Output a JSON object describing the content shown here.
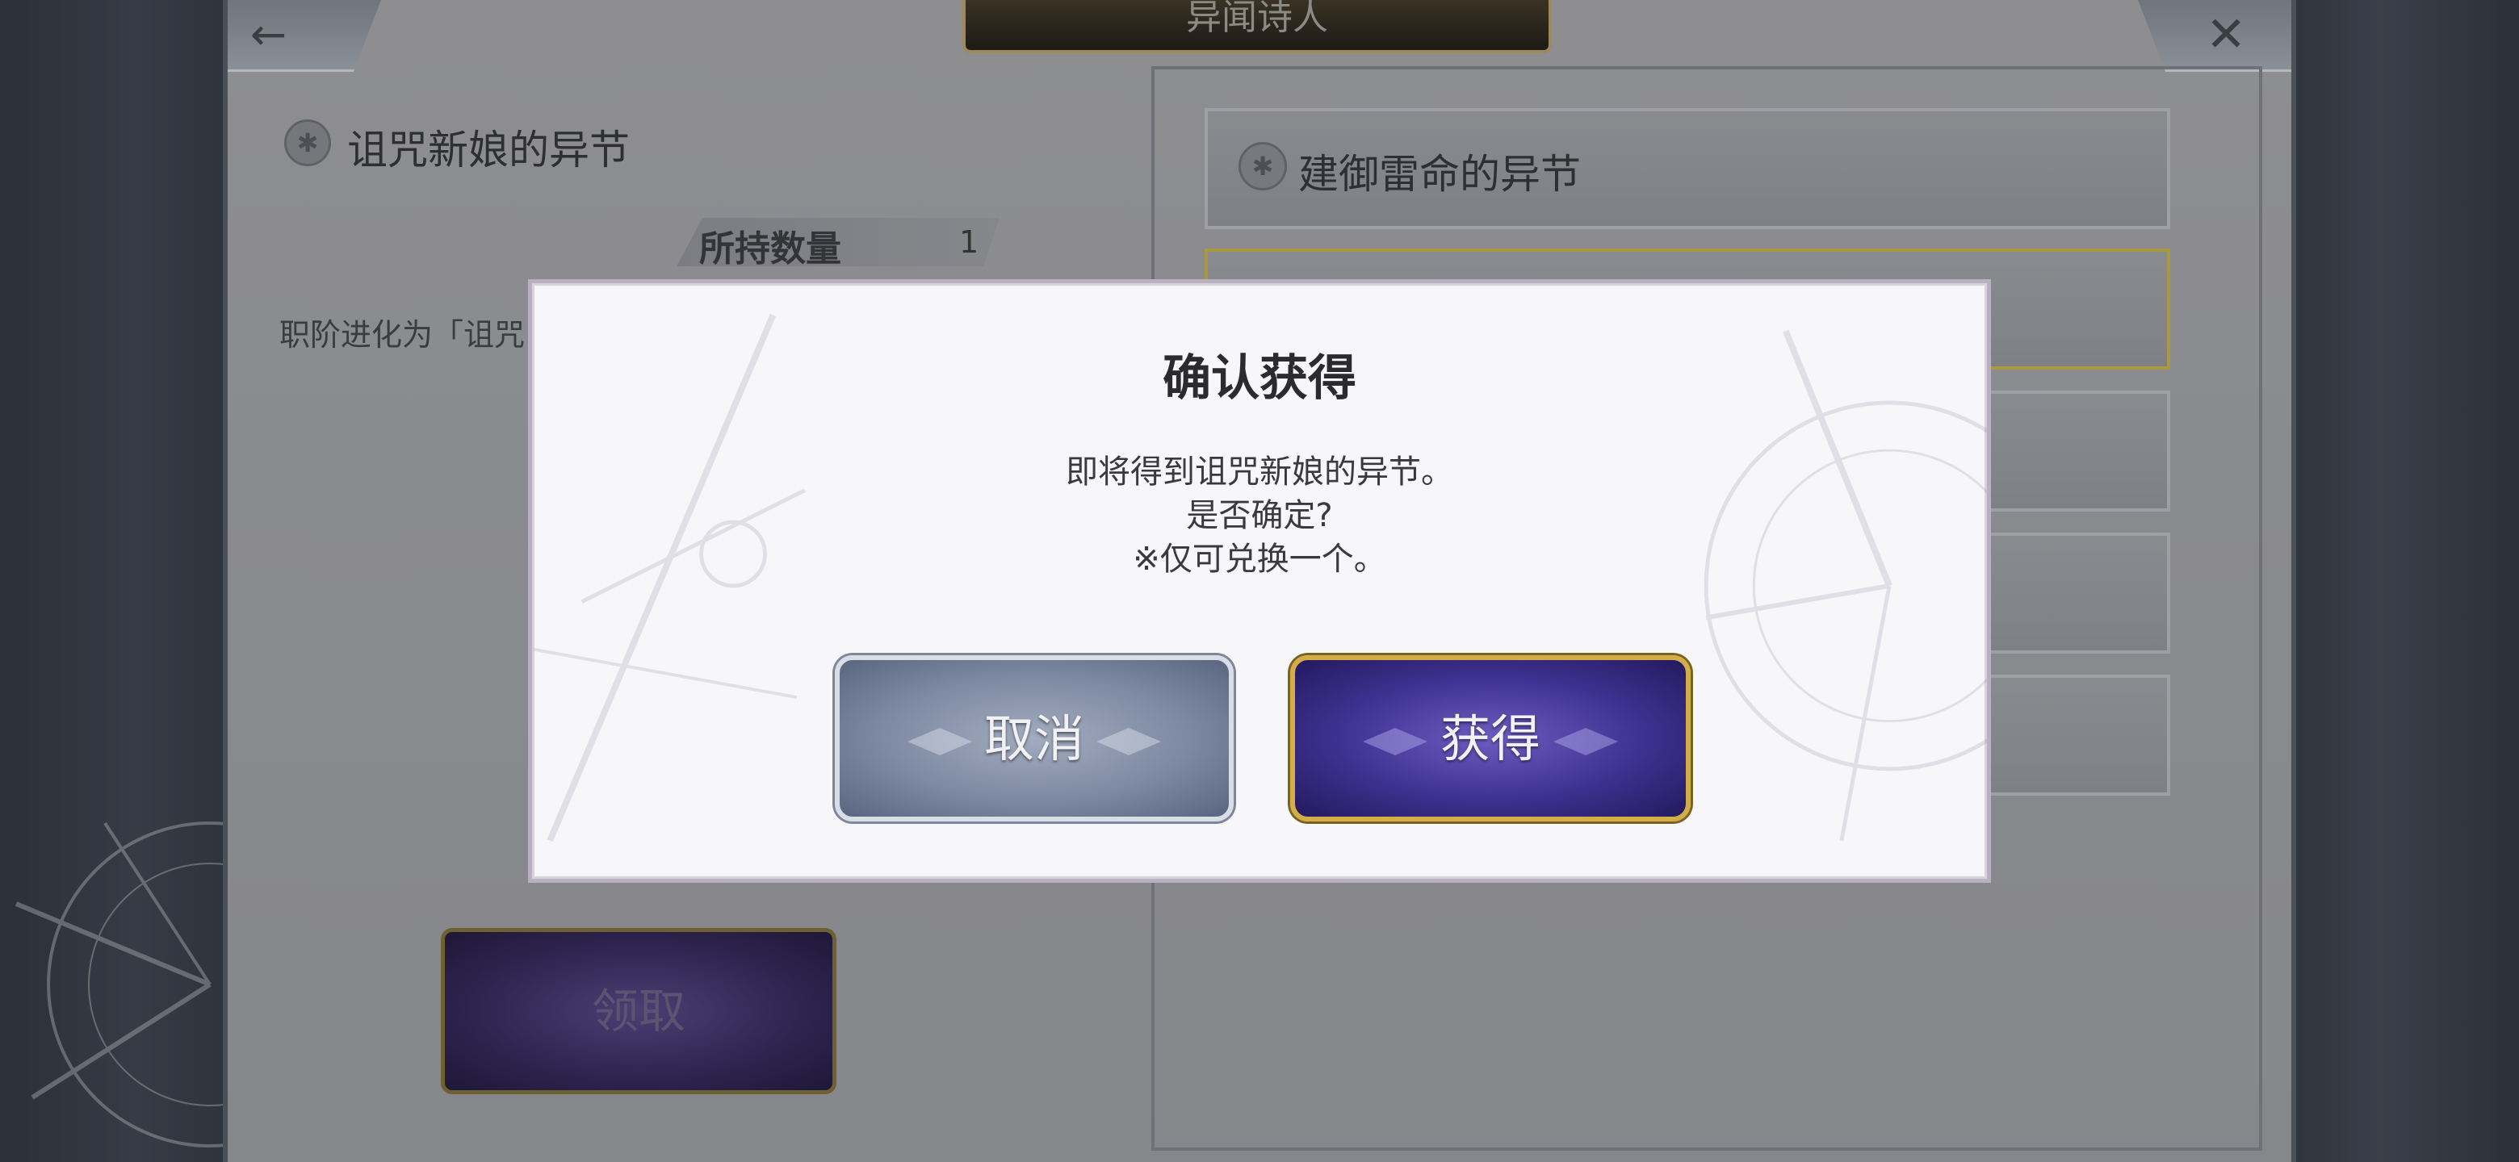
{
  "header": {
    "title": "异闻诗人",
    "back_icon": "←",
    "close_icon": "✕"
  },
  "left_panel": {
    "book_icon": "✱",
    "title": "诅咒新娘的异节",
    "quantity_label": "所持数量",
    "quantity_value": "1",
    "description": "职阶进化为「诅咒",
    "receive_button": "领取"
  },
  "right_panel": {
    "book_icon": "✱",
    "card_title": "建御雷命的异节"
  },
  "dialog": {
    "title": "确认获得",
    "line1": "即将得到诅咒新娘的异节。",
    "line2": "是否确定?",
    "line3": "※仅可兑换一个。",
    "cancel_label": "取消",
    "confirm_label": "获得"
  },
  "colors": {
    "cancel_button": "#7e8aa2",
    "confirm_button": "#3f3190",
    "confirm_border": "#d4ad48",
    "dialog_bg": "#f7f6f9"
  }
}
